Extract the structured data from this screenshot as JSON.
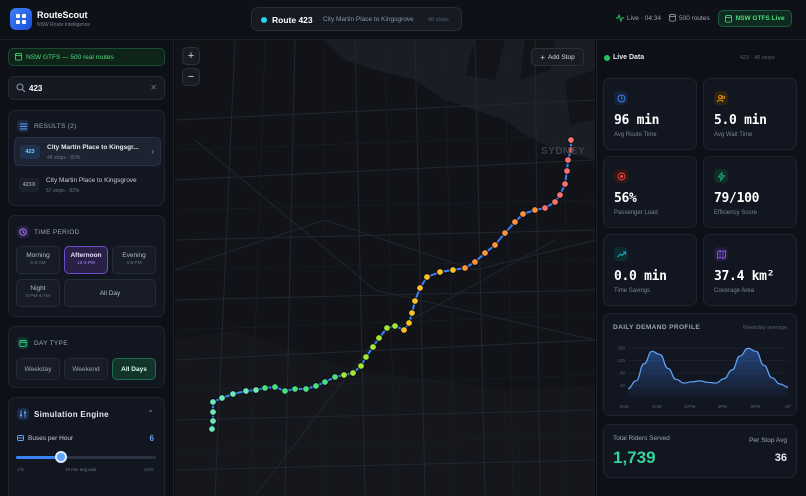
{
  "app": {
    "name": "RouteScout",
    "subtitle": "NSW Route Intelligence"
  },
  "header": {
    "route_name": "Route 423",
    "route_desc": "City Martin Place to Kingsgrove",
    "route_stops": "48 stops",
    "live_status": "Live · 04:34",
    "routes_count": "500 routes",
    "gtfs_button": "NSW GTFS Live"
  },
  "left": {
    "gtfs_badge": "NSW GTFS — 500 real routes",
    "search_value": "423",
    "results_title": "RESULTS (2)",
    "results": [
      {
        "code": "423",
        "name": "City Martin Place to Kingsgr...",
        "meta": "48 stops · 82%"
      },
      {
        "code": "423X",
        "name": "City Martin Place to Kingsgrove",
        "meta": "57 stops · 82%"
      }
    ],
    "time_period_title": "TIME PERIOD",
    "time_periods": [
      {
        "label": "Morning",
        "sub": "6-9 AM"
      },
      {
        "label": "Afternoon",
        "sub": "12-3 PM"
      },
      {
        "label": "Evening",
        "sub": "4-8 PM"
      },
      {
        "label": "Night",
        "sub": "8 PM-4 AM"
      },
      {
        "label": "All Day",
        "sub": ""
      }
    ],
    "day_type_title": "DAY TYPE",
    "day_types": [
      "Weekday",
      "Weekend",
      "All Days"
    ],
    "sim_title": "Simulation Engine",
    "buses_label": "Buses per Hour",
    "buses_value": "6",
    "slider_value": 0.32,
    "slider_min": "2/hr",
    "slider_mid": "10 min avg wait",
    "slider_max": "15/hr"
  },
  "map": {
    "add_stop": "Add Stop",
    "zoom_in": "+",
    "zoom_out": "−",
    "city_label": "SYDNEY"
  },
  "right": {
    "live_title": "Live Data",
    "live_meta": "423 · 48 stops",
    "metrics": [
      {
        "value": "96 min",
        "label": "Avg Route Time",
        "icon": "clock-icon",
        "color": "#3b82f6"
      },
      {
        "value": "5.0 min",
        "label": "Avg Wait Time",
        "icon": "users-icon",
        "color": "#f59e0b"
      },
      {
        "value": "56%",
        "label": "Passenger Load",
        "icon": "target-icon",
        "color": "#ef4444"
      },
      {
        "value": "79/100",
        "label": "Efficiency Score",
        "icon": "bolt-icon",
        "color": "#10b981"
      },
      {
        "value": "0.0 min",
        "label": "Time Savings",
        "icon": "trend-up-icon",
        "color": "#06b6d4"
      },
      {
        "value": "37.4 km²",
        "label": "Coverage Area",
        "icon": "map-icon",
        "color": "#8b5cf6"
      }
    ],
    "demand_title": "DAILY DEMAND PROFILE",
    "demand_sub": "Weekday average",
    "total_riders_label": "Total Riders Served",
    "total_riders_value": "1,739",
    "per_stop_label": "Per Stop Avg",
    "per_stop_value": "36"
  },
  "chart_data": {
    "type": "area",
    "title": "DAILY DEMAND PROFILE",
    "subtitle": "Weekday average",
    "x_ticks": [
      "3AM",
      "6AM",
      "12PM",
      "3PM",
      "9PM",
      "6P"
    ],
    "y_ticks": [
      "160",
      "120",
      "80",
      "40"
    ],
    "ylim": [
      0,
      180
    ],
    "x": [
      0,
      1,
      2,
      3,
      4,
      5,
      6,
      7,
      8,
      9,
      10,
      11,
      12,
      13,
      14,
      15,
      16,
      17,
      18,
      19,
      20
    ],
    "values": [
      30,
      55,
      110,
      150,
      140,
      95,
      60,
      48,
      52,
      55,
      50,
      48,
      62,
      90,
      135,
      160,
      150,
      105,
      65,
      45,
      35
    ]
  }
}
